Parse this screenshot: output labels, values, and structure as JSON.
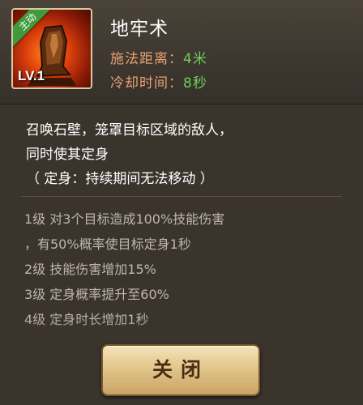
{
  "skill": {
    "badge": "主动",
    "level": "LV.1",
    "name": "地牢术",
    "range_label": "施法距离：",
    "range_value": "4米",
    "cooldown_label": "冷却时间：",
    "cooldown_value": "8秒"
  },
  "description": {
    "lines": [
      "召唤石壁，笼罩目标区域的敌人，",
      "同时使其定身",
      "（ 定身：持续期间无法移动 ）"
    ]
  },
  "levels": [
    "1级 对3个目标造成100%技能伤害",
    "，有50%概率使目标定身1秒",
    "2级 技能伤害增加15%",
    "3级 定身概率提升至60%",
    "4级 定身时长增加1秒"
  ],
  "buttons": {
    "close": "关闭"
  },
  "colors": {
    "stat_label": "#e9a172",
    "stat_value": "#6fce5a",
    "badge": "#3f9a3a"
  },
  "icons": {
    "skill": "stone-wall-skill-icon"
  }
}
